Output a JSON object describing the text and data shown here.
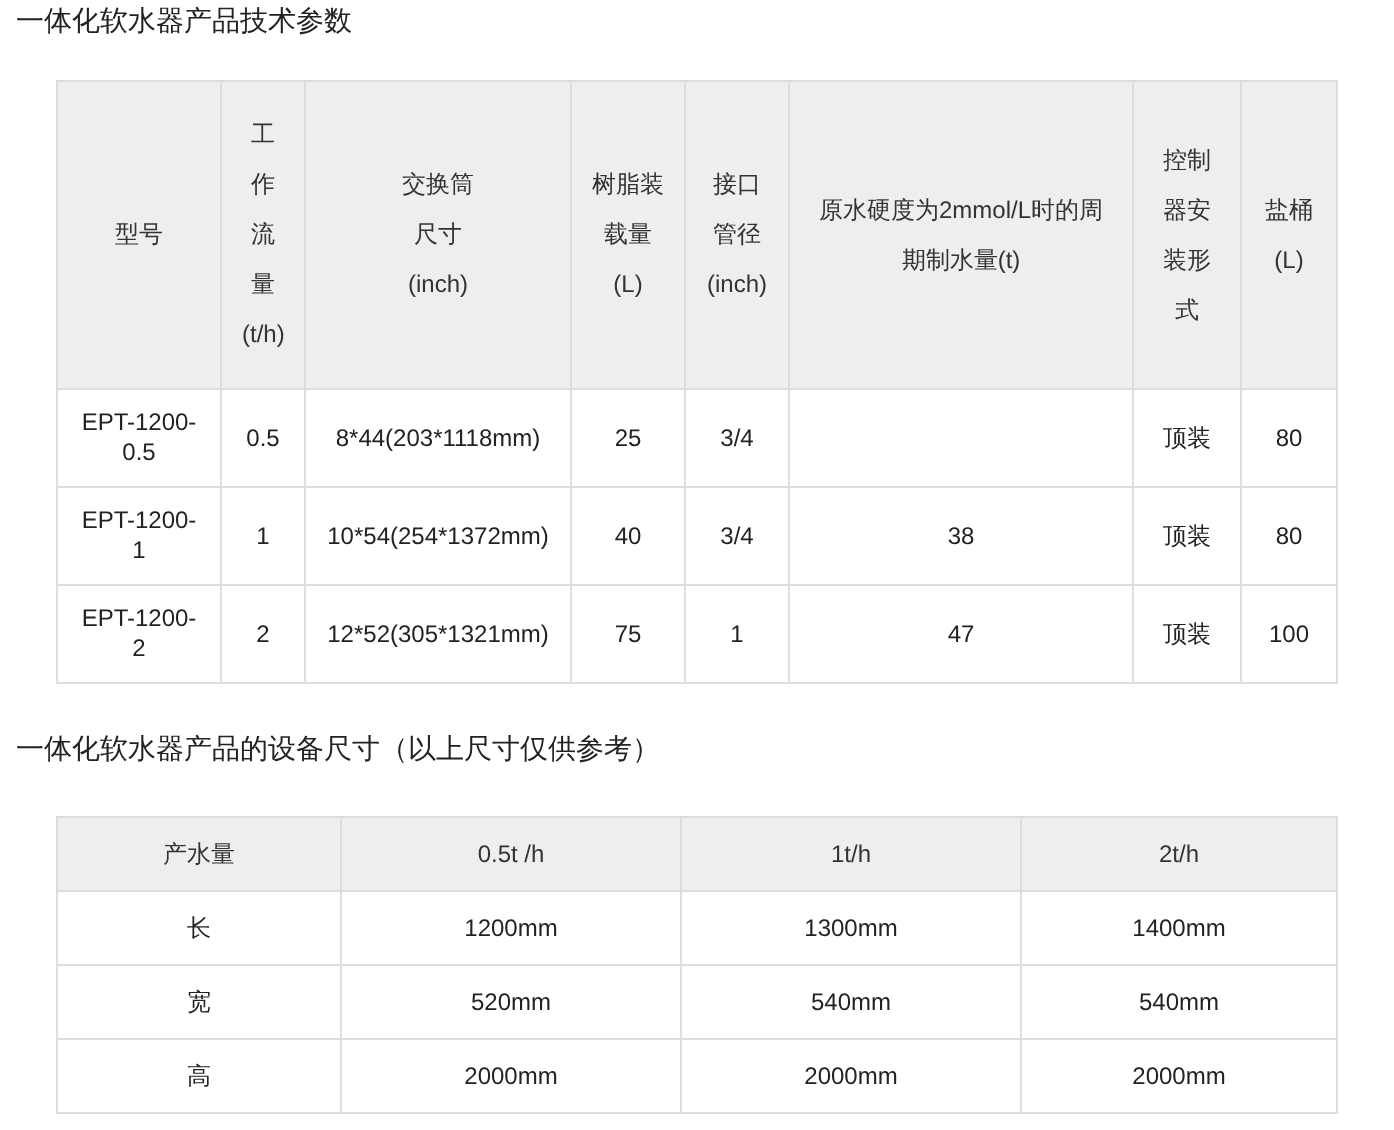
{
  "sections": [
    {
      "title": "一体化软水器产品技术参数",
      "kind": "specs",
      "table": {
        "columns": [
          "型号",
          "工作流量(t/h)",
          "交换筒尺寸(inch)",
          "树脂装载量(L)",
          "接口管径(inch)",
          "原水硬度为2mmol/L时的周期制水量(t)",
          "控制器安装形式",
          "盐桶(L)"
        ],
        "rows": [
          [
            "EPT-1200-0.5",
            "0.5",
            "8*44(203*1118mm)",
            "25",
            "3/4",
            null,
            "顶装",
            "80"
          ],
          [
            "EPT-1200-1",
            "1",
            "10*54(254*1372mm)",
            "40",
            "3/4",
            "38",
            "顶装",
            "80"
          ],
          [
            "EPT-1200-2",
            "2",
            "12*52(305*1321mm)",
            "75",
            "1",
            "47",
            "顶装",
            "100"
          ]
        ]
      }
    },
    {
      "title": "一体化软水器产品的设备尺寸（以上尺寸仅供参考）",
      "kind": "dims",
      "table": {
        "columns": [
          "产水量",
          "0.5t /h",
          "1t/h",
          "2t/h"
        ],
        "rows": [
          [
            "长",
            "1200mm",
            "1300mm",
            "1400mm"
          ],
          [
            "宽",
            "520mm",
            "540mm",
            "540mm"
          ],
          [
            "高",
            "2000mm",
            "2000mm",
            "2000mm"
          ]
        ]
      }
    }
  ]
}
